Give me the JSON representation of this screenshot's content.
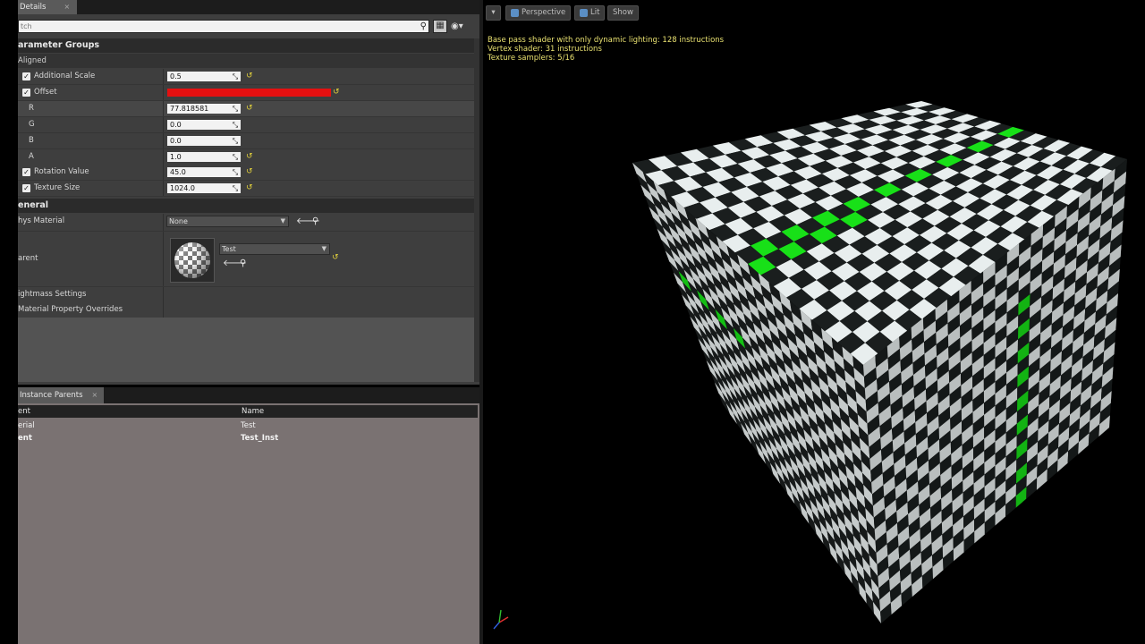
{
  "details_panel": {
    "tab_label": "Details",
    "tab_close": "×",
    "search": {
      "value": "",
      "placeholder": "tch"
    },
    "categories": {
      "parameter_groups": "arameter Groups",
      "aligned": "Aligned",
      "general": "eneral"
    },
    "params": {
      "additional_scale": {
        "label": "Additional Scale",
        "value": "0.5"
      },
      "offset": {
        "label": "Offset",
        "color": "#e51010"
      },
      "r": {
        "label": "R",
        "value": "77.818581"
      },
      "g": {
        "label": "G",
        "value": "0.0"
      },
      "b": {
        "label": "B",
        "value": "0.0"
      },
      "a": {
        "label": "A",
        "value": "1.0"
      },
      "rotation_value": {
        "label": "Rotation Value",
        "value": "45.0"
      },
      "texture_size": {
        "label": "Texture Size",
        "value": "1024.0"
      }
    },
    "general": {
      "phys_material": {
        "label": "hys Material",
        "value": "None"
      },
      "parent": {
        "label": "arent",
        "value": "Test"
      },
      "lightmass_settings": "ightmass Settings",
      "material_property_overrides": "Material Property Overrides"
    }
  },
  "instance_parents_panel": {
    "tab_label": "Instance Parents",
    "tab_close": "×",
    "columns": {
      "parent": "ent",
      "name": "Name"
    },
    "rows": [
      {
        "parent": "erial",
        "name": "Test"
      },
      {
        "parent": "ent",
        "name": "Test_Inst"
      }
    ]
  },
  "viewport": {
    "menu_arrow": "▾",
    "perspective_label": "Perspective",
    "lit_label": "Lit",
    "show_label": "Show",
    "stats": [
      "Base pass shader with only dynamic lighting: 128 instructions",
      "Vertex shader: 31 instructions",
      "Texture samplers: 5/16"
    ],
    "checker_colors": {
      "light": "#e8eeee",
      "dark": "#1a1e1e",
      "accent": "#18e018"
    }
  }
}
